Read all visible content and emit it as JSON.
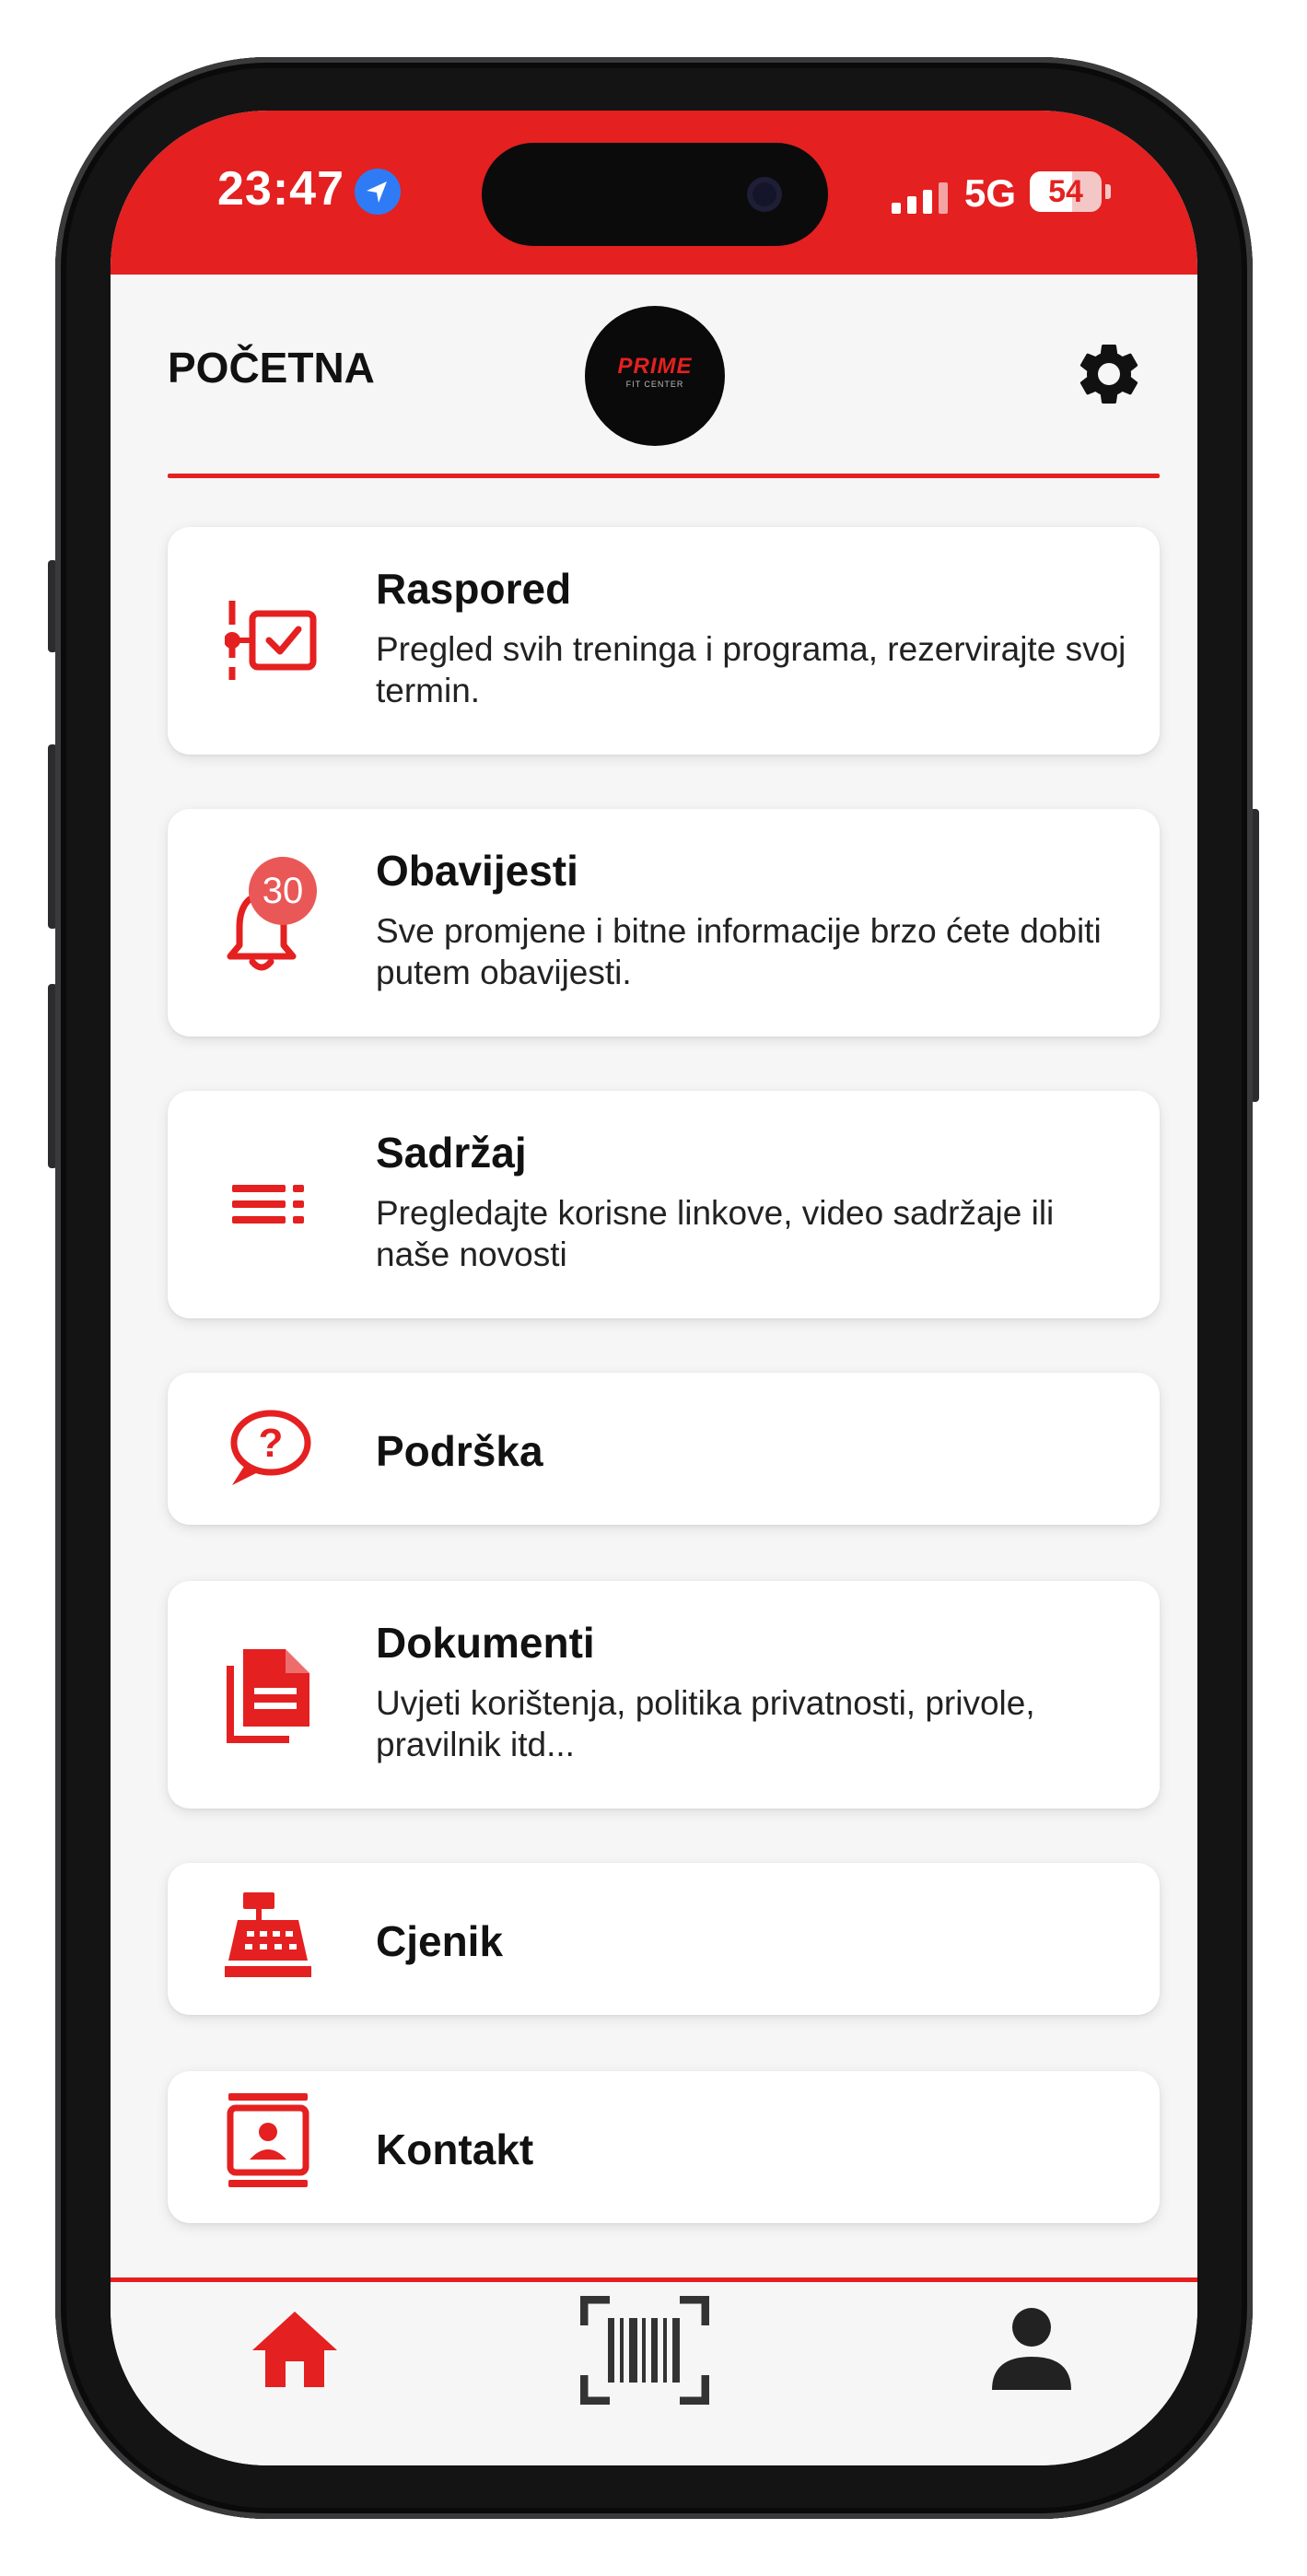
{
  "status_bar": {
    "time": "23:47",
    "network": "5G",
    "battery": "54"
  },
  "header": {
    "title": "POČETNA",
    "logo_text": "PRIME",
    "logo_subtext": "FIT CENTER",
    "settings_icon": "gear-icon"
  },
  "menu": [
    {
      "title": "Raspored",
      "desc": "Pregled svih treninga i programa, rezervirajte svoj termin.",
      "icon": "schedule-check-icon"
    },
    {
      "title": "Obavijesti",
      "desc": "Sve promjene i bitne informacije brzo ćete dobiti putem obavijesti.",
      "icon": "bell-icon",
      "badge": "30"
    },
    {
      "title": "Sadržaj",
      "desc": "Pregledajte korisne linkove, video sadržaje ili naše novosti",
      "icon": "list-icon"
    },
    {
      "title": "Podrška",
      "icon": "help-chat-icon"
    },
    {
      "title": "Dokumenti",
      "desc": "Uvjeti korištenja, politika privatnosti, privole, pravilnik itd...",
      "icon": "documents-icon"
    },
    {
      "title": "Cjenik",
      "icon": "cash-register-icon"
    },
    {
      "title": "Kontakt",
      "icon": "contact-card-icon"
    }
  ],
  "bottom_nav": {
    "home_icon": "home-icon",
    "scan_icon": "barcode-scan-icon",
    "profile_icon": "profile-icon"
  },
  "colors": {
    "accent": "#e42020",
    "background": "#f6f6f6",
    "badge": "#ea5757"
  }
}
